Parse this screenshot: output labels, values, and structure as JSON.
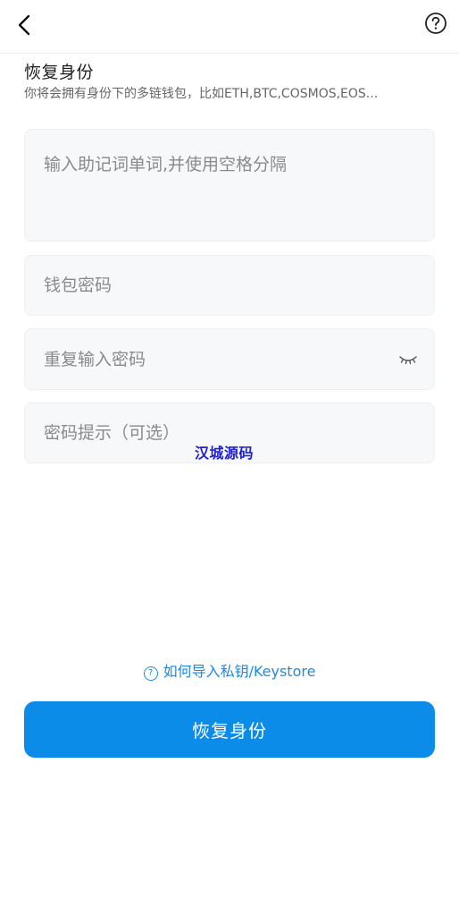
{
  "header": {
    "back_icon": "chevron-left-icon",
    "help_icon": "question-circle-icon"
  },
  "page": {
    "title": "恢复身份",
    "subtitle": "你将会拥有身份下的多链钱包，比如ETH,BTC,COSMOS,EOS..."
  },
  "form": {
    "mnemonic_placeholder": "输入助记词单词,并使用空格分隔",
    "password_placeholder": "钱包密码",
    "repeat_password_placeholder": "重复输入密码",
    "password_hint_placeholder": "密码提示（可选）",
    "eye_icon": "eye-closed-icon"
  },
  "watermark": "汉城源码",
  "import_link": {
    "icon": "question-circle-icon",
    "icon_glyph": "?",
    "label": "如何导入私钥/Keystore"
  },
  "primary_button": {
    "label": "恢复身份"
  },
  "colors": {
    "primary": "#0b8ce9",
    "link": "#1e88e5",
    "field_bg": "#f7f8fa",
    "watermark": "#2020d8"
  }
}
